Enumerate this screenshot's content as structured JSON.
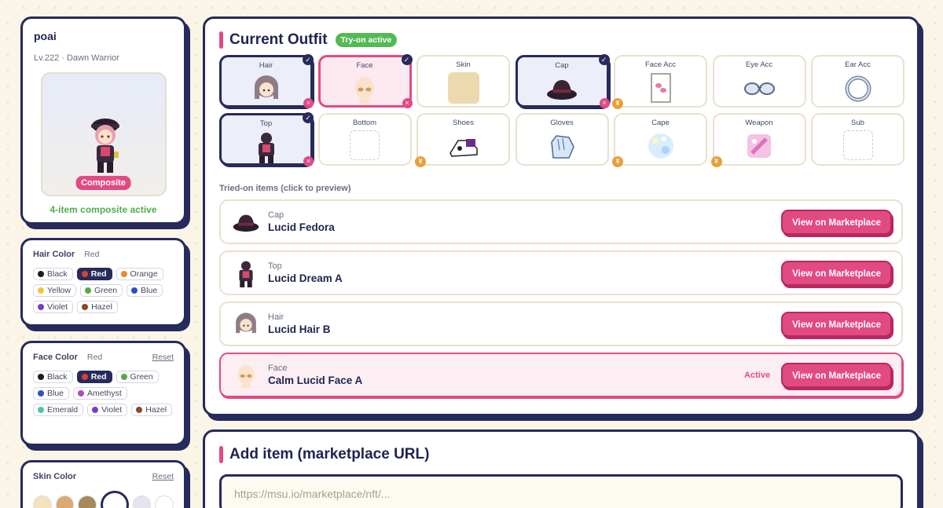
{
  "profile": {
    "name": "poai",
    "level": "Lv.222 · Dawn Warrior",
    "composite_badge": "Composite",
    "status": "4-item composite active"
  },
  "hair_color": {
    "title": "Hair Color",
    "selected": "Red",
    "options": [
      {
        "label": "Black",
        "color": "#1c1c1c"
      },
      {
        "label": "Red",
        "color": "#d9412e",
        "selected": true
      },
      {
        "label": "Orange",
        "color": "#ec8a2c"
      },
      {
        "label": "Yellow",
        "color": "#f0c53a"
      },
      {
        "label": "Green",
        "color": "#5aa844"
      },
      {
        "label": "Blue",
        "color": "#2e4fc2"
      },
      {
        "label": "Violet",
        "color": "#7c3ccb"
      },
      {
        "label": "Hazel",
        "color": "#8b4a2a"
      }
    ]
  },
  "face_color": {
    "title": "Face Color",
    "selected": "Red",
    "reset": "Reset",
    "options": [
      {
        "label": "Black",
        "color": "#1c1c1c"
      },
      {
        "label": "Red",
        "color": "#d9412e",
        "selected": true
      },
      {
        "label": "Green",
        "color": "#5aa844"
      },
      {
        "label": "Blue",
        "color": "#2e4fc2"
      },
      {
        "label": "Amethyst",
        "color": "#b04ac2"
      },
      {
        "label": "Emerald",
        "color": "#4fc2b0"
      },
      {
        "label": "Violet",
        "color": "#7c3ccb"
      },
      {
        "label": "Hazel",
        "color": "#8b4a2a"
      }
    ]
  },
  "skin_color": {
    "title": "Skin Color",
    "reset": "Reset",
    "swatches": [
      "#f6e3bd",
      "#d9aa72",
      "#a68a5c",
      "#ffffff",
      "#e4e4ee",
      "#ffffff"
    ],
    "selected_index": 3
  },
  "outfit": {
    "title": "Current Outfit",
    "badge": "Try-on active",
    "slots": [
      {
        "label": "Hair",
        "state": "equipped",
        "icon": "hair-icon"
      },
      {
        "label": "Face",
        "state": "equipped-face",
        "icon": "face-icon"
      },
      {
        "label": "Skin",
        "state": "skin",
        "icon": "skin-swatch-icon"
      },
      {
        "label": "Cap",
        "state": "equipped",
        "icon": "fedora-icon"
      },
      {
        "label": "Face Acc",
        "state": "coin",
        "icon": "face-accessory-icon"
      },
      {
        "label": "Eye Acc",
        "state": "plain",
        "icon": "glasses-icon"
      },
      {
        "label": "Ear Acc",
        "state": "plain",
        "icon": "earring-icon"
      },
      {
        "label": "Top",
        "state": "equipped",
        "icon": "top-outfit-icon"
      },
      {
        "label": "Bottom",
        "state": "empty",
        "icon": ""
      },
      {
        "label": "Shoes",
        "state": "coin",
        "icon": "shoes-icon"
      },
      {
        "label": "Gloves",
        "state": "plain",
        "icon": "gloves-icon"
      },
      {
        "label": "Cape",
        "state": "coin",
        "icon": "cape-icon"
      },
      {
        "label": "Weapon",
        "state": "coin",
        "icon": "weapon-icon"
      },
      {
        "label": "Sub",
        "state": "empty",
        "icon": ""
      }
    ],
    "tried_label": "Tried-on items (click to preview)",
    "tried_items": [
      {
        "type": "Cap",
        "name": "Lucid Fedora",
        "button": "View on Marketplace",
        "active": false,
        "icon": "fedora-icon"
      },
      {
        "type": "Top",
        "name": "Lucid Dream A",
        "button": "View on Marketplace",
        "active": false,
        "icon": "top-outfit-icon"
      },
      {
        "type": "Hair",
        "name": "Lucid Hair B",
        "button": "View on Marketplace",
        "active": false,
        "icon": "hair-icon"
      },
      {
        "type": "Face",
        "name": "Calm Lucid Face A",
        "button": "View on Marketplace",
        "active": true,
        "active_label": "Active",
        "icon": "face-icon"
      }
    ],
    "check_glyph": "✓",
    "remove_glyph": "×",
    "coin_glyph": "¥"
  },
  "add_item": {
    "title": "Add item (marketplace URL)",
    "placeholder": "https://msu.io/marketplace/nft/..."
  }
}
